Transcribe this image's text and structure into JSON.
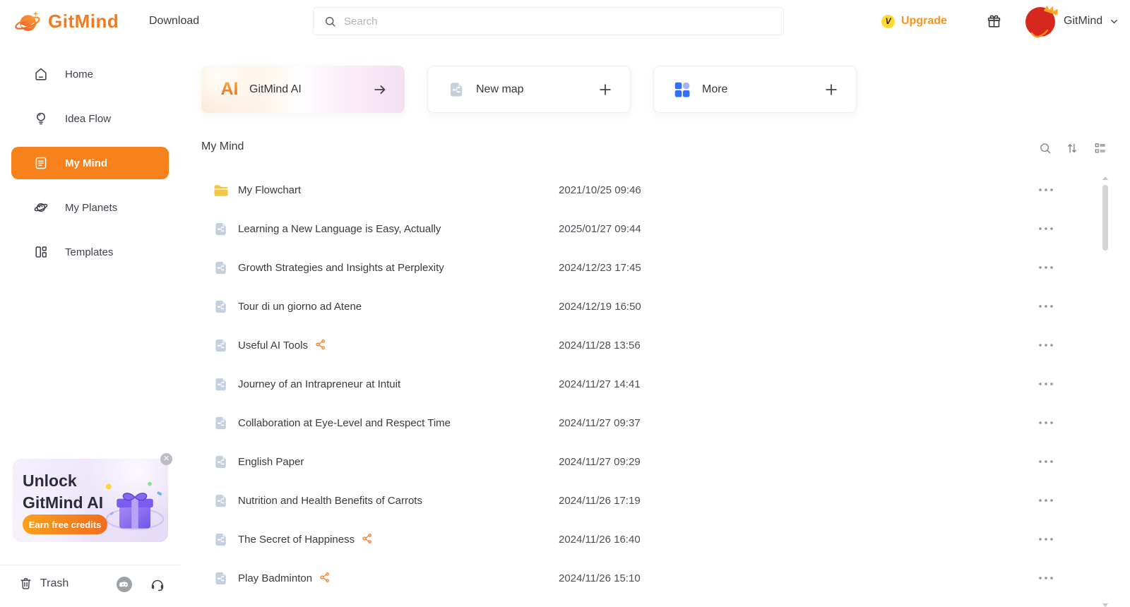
{
  "header": {
    "logo_text": "GitMind",
    "nav_download": "Download",
    "search_placeholder": "Search",
    "search_value": "",
    "upgrade_label": "Upgrade",
    "upgrade_badge": "V",
    "account_name": "GitMind"
  },
  "sidebar": {
    "items": [
      {
        "label": "Home",
        "active": false
      },
      {
        "label": "Idea Flow",
        "active": false
      },
      {
        "label": "My Mind",
        "active": true
      },
      {
        "label": "My Planets",
        "active": false
      },
      {
        "label": "Templates",
        "active": false
      }
    ],
    "promo": {
      "title_line1": "Unlock",
      "title_line2": "GitMind AI",
      "button_label": "Earn free credits",
      "close_glyph": "✕"
    },
    "trash_label": "Trash"
  },
  "cards": [
    {
      "label": "GitMind AI",
      "icon": "ai-logo",
      "action": "arrow-right"
    },
    {
      "label": "New map",
      "icon": "mindmap-document",
      "action": "plus",
      "action_glyph": "+"
    },
    {
      "label": "More",
      "icon": "apps-grid",
      "action": "plus",
      "action_glyph": "+"
    }
  ],
  "main": {
    "section_title": "My Mind",
    "tools": [
      "search",
      "sort",
      "list-view"
    ],
    "rows": [
      {
        "name": "My Flowchart",
        "date": "2021/10/25 09:46",
        "is_folder": true,
        "is_file": false,
        "shared": false
      },
      {
        "name": "Learning a New Language is Easy, Actually",
        "date": "2025/01/27 09:44",
        "is_folder": false,
        "is_file": true,
        "shared": false
      },
      {
        "name": "Growth Strategies and Insights at Perplexity",
        "date": "2024/12/23 17:45",
        "is_folder": false,
        "is_file": true,
        "shared": false
      },
      {
        "name": "Tour di un giorno ad Atene",
        "date": "2024/12/19 16:50",
        "is_folder": false,
        "is_file": true,
        "shared": false
      },
      {
        "name": "Useful AI Tools",
        "date": "2024/11/28 13:56",
        "is_folder": false,
        "is_file": true,
        "shared": true
      },
      {
        "name": "Journey of an Intrapreneur at Intuit",
        "date": "2024/11/27 14:41",
        "is_folder": false,
        "is_file": true,
        "shared": false
      },
      {
        "name": "Collaboration at Eye-Level and Respect Time",
        "date": "2024/11/27 09:37",
        "is_folder": false,
        "is_file": true,
        "shared": false
      },
      {
        "name": "English Paper",
        "date": "2024/11/27 09:29",
        "is_folder": false,
        "is_file": true,
        "shared": false
      },
      {
        "name": "Nutrition and Health Benefits of Carrots",
        "date": "2024/11/26 17:19",
        "is_folder": false,
        "is_file": true,
        "shared": false
      },
      {
        "name": "The Secret of Happiness",
        "date": "2024/11/26 16:40",
        "is_folder": false,
        "is_file": true,
        "shared": true
      },
      {
        "name": "Play Badminton",
        "date": "2024/11/26 15:10",
        "is_folder": false,
        "is_file": true,
        "shared": true
      }
    ]
  },
  "icons": {
    "search": "magnifier",
    "sort": "arrows-up-down",
    "view": "list-view",
    "row_menu": "ellipsis",
    "share": "share-nodes",
    "folder": "folder",
    "file": "mindmap-document",
    "gift": "gift-box",
    "account_chevron": "chevron-down"
  },
  "colors": {
    "accent_orange": "#f7821b",
    "upgrade_orange": "#f7941d",
    "folder_yellow": "#f6c544",
    "file_bluegray": "#c8d3e0",
    "share_orange": "#f7781e",
    "more_blue": "#3370f6",
    "more_lilac": "#a9b1f2",
    "vip_yellow": "#ffda2e",
    "avatar_red": "#d7281f"
  }
}
